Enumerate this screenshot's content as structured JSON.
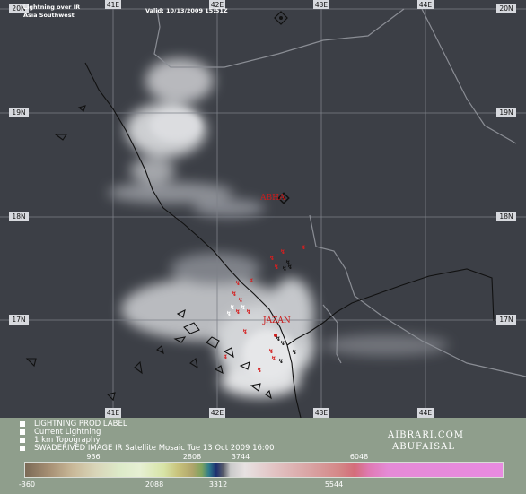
{
  "header": {
    "title_line1": "Lightning over IR",
    "title_line2": "Asia Southwest",
    "valid": "Valid: 10/13/2009 15:51Z"
  },
  "map": {
    "lon_labels": [
      "41E",
      "42E",
      "43E",
      "44E"
    ],
    "lat_labels": [
      "20N",
      "19N",
      "18N",
      "17N"
    ],
    "cities": [
      {
        "name": "ABHA"
      },
      {
        "name": "JAZAN"
      }
    ],
    "colors": {
      "background": "#3c3f46",
      "grid": "#7d8088",
      "coast": "#111111",
      "city": "#cc1b1b"
    }
  },
  "legend": {
    "items": [
      "LIGHTNING PROD LABEL",
      "Current Lightning",
      "1 km Topography",
      "SWADERIVED IMAGE IR Satellite Mosaic Tue 13 Oct 2009 16:00"
    ]
  },
  "branding": {
    "line1": "AIBRARI.COM",
    "line2": "ABUFAISAL"
  },
  "colorbar": {
    "top_ticks": [
      {
        "label": "936"
      },
      {
        "label": "2808"
      },
      {
        "label": "3744"
      },
      {
        "label": "6048"
      }
    ],
    "bottom_ticks": [
      {
        "label": "-360"
      },
      {
        "label": "2088"
      },
      {
        "label": "3312"
      },
      {
        "label": "5544"
      }
    ]
  }
}
